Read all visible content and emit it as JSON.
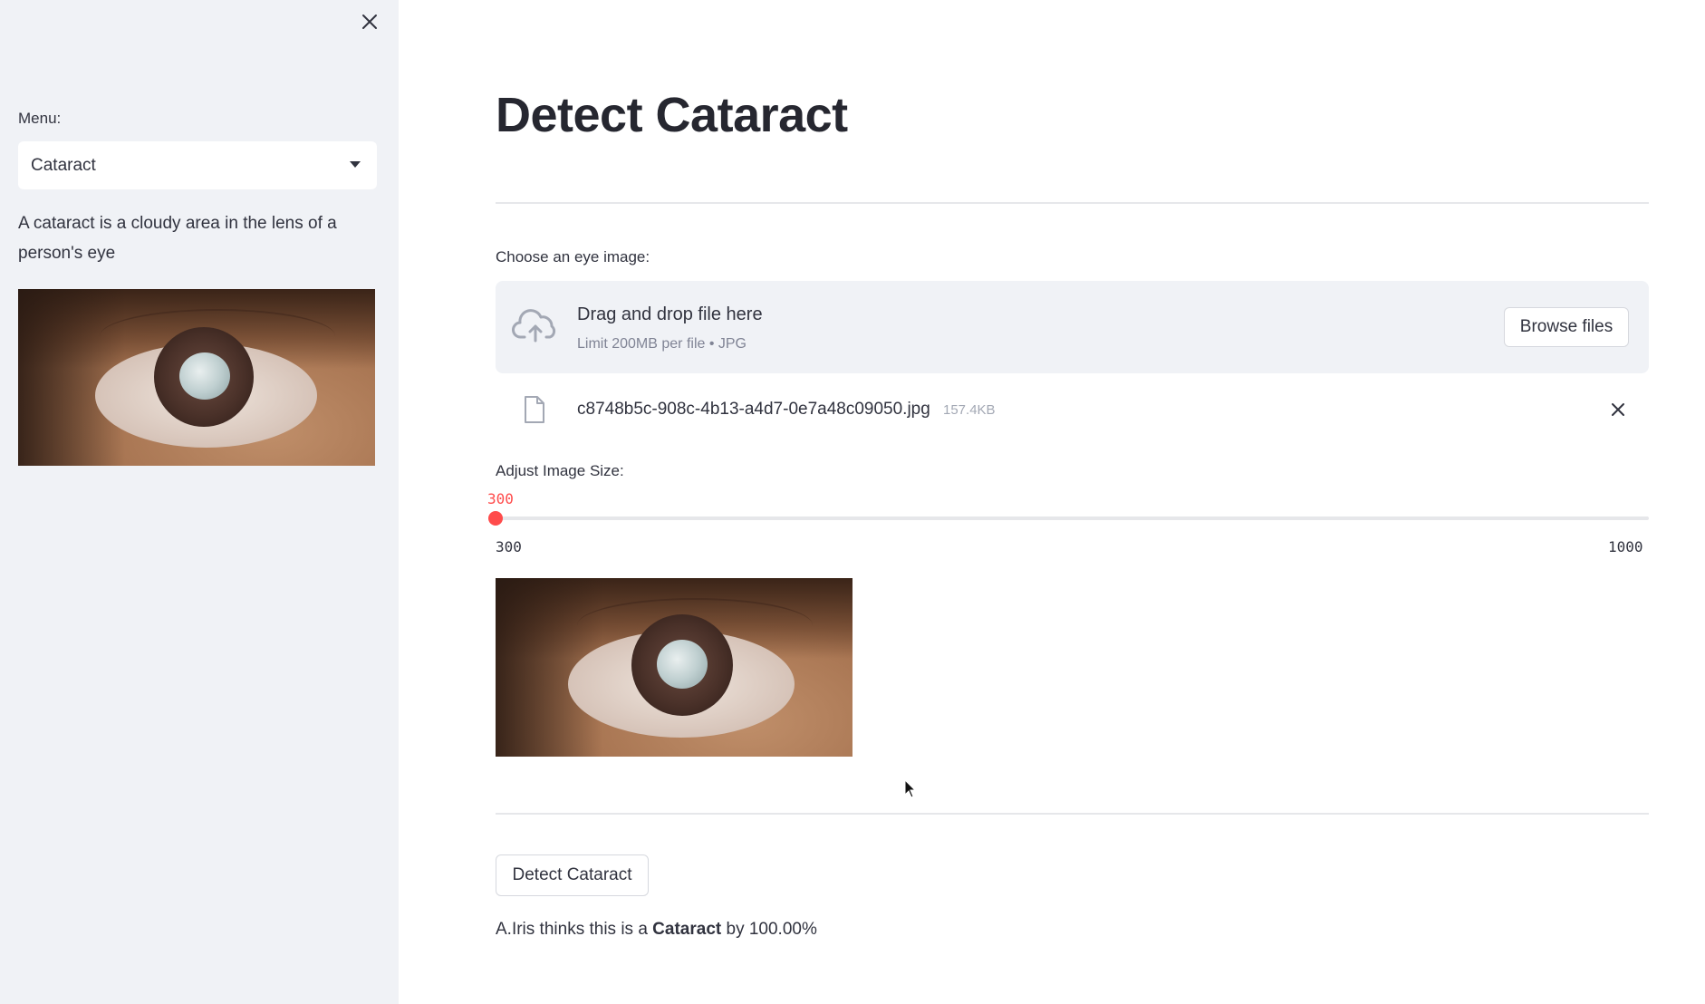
{
  "sidebar": {
    "close_icon": "close-icon",
    "menu_label": "Menu:",
    "menu_selected": "Cataract",
    "description": "A cataract is a cloudy area in the lens of a person's eye"
  },
  "main": {
    "title": "Detect Cataract",
    "uploader": {
      "label": "Choose an eye image:",
      "icon": "cloud-upload-icon",
      "drop_text": "Drag and drop file here",
      "limit_text": "Limit 200MB per file • JPG",
      "browse_label": "Browse files"
    },
    "uploaded_file": {
      "icon": "file-icon",
      "name": "c8748b5c-908c-4b13-a4d7-0e7a48c09050.jpg",
      "size": "157.4KB",
      "remove_icon": "close-icon"
    },
    "slider": {
      "label": "Adjust Image Size:",
      "value": "300",
      "min": "300",
      "max": "1000",
      "fraction": 0.0
    },
    "detect_button_label": "Detect Cataract",
    "result": {
      "prefix": "A.Iris thinks this is a ",
      "label": "Cataract",
      "suffix": " by 100.00%"
    }
  },
  "colors": {
    "accent": "#ff4b4b",
    "sidebar_bg": "#f0f2f6",
    "text": "#31333f"
  }
}
